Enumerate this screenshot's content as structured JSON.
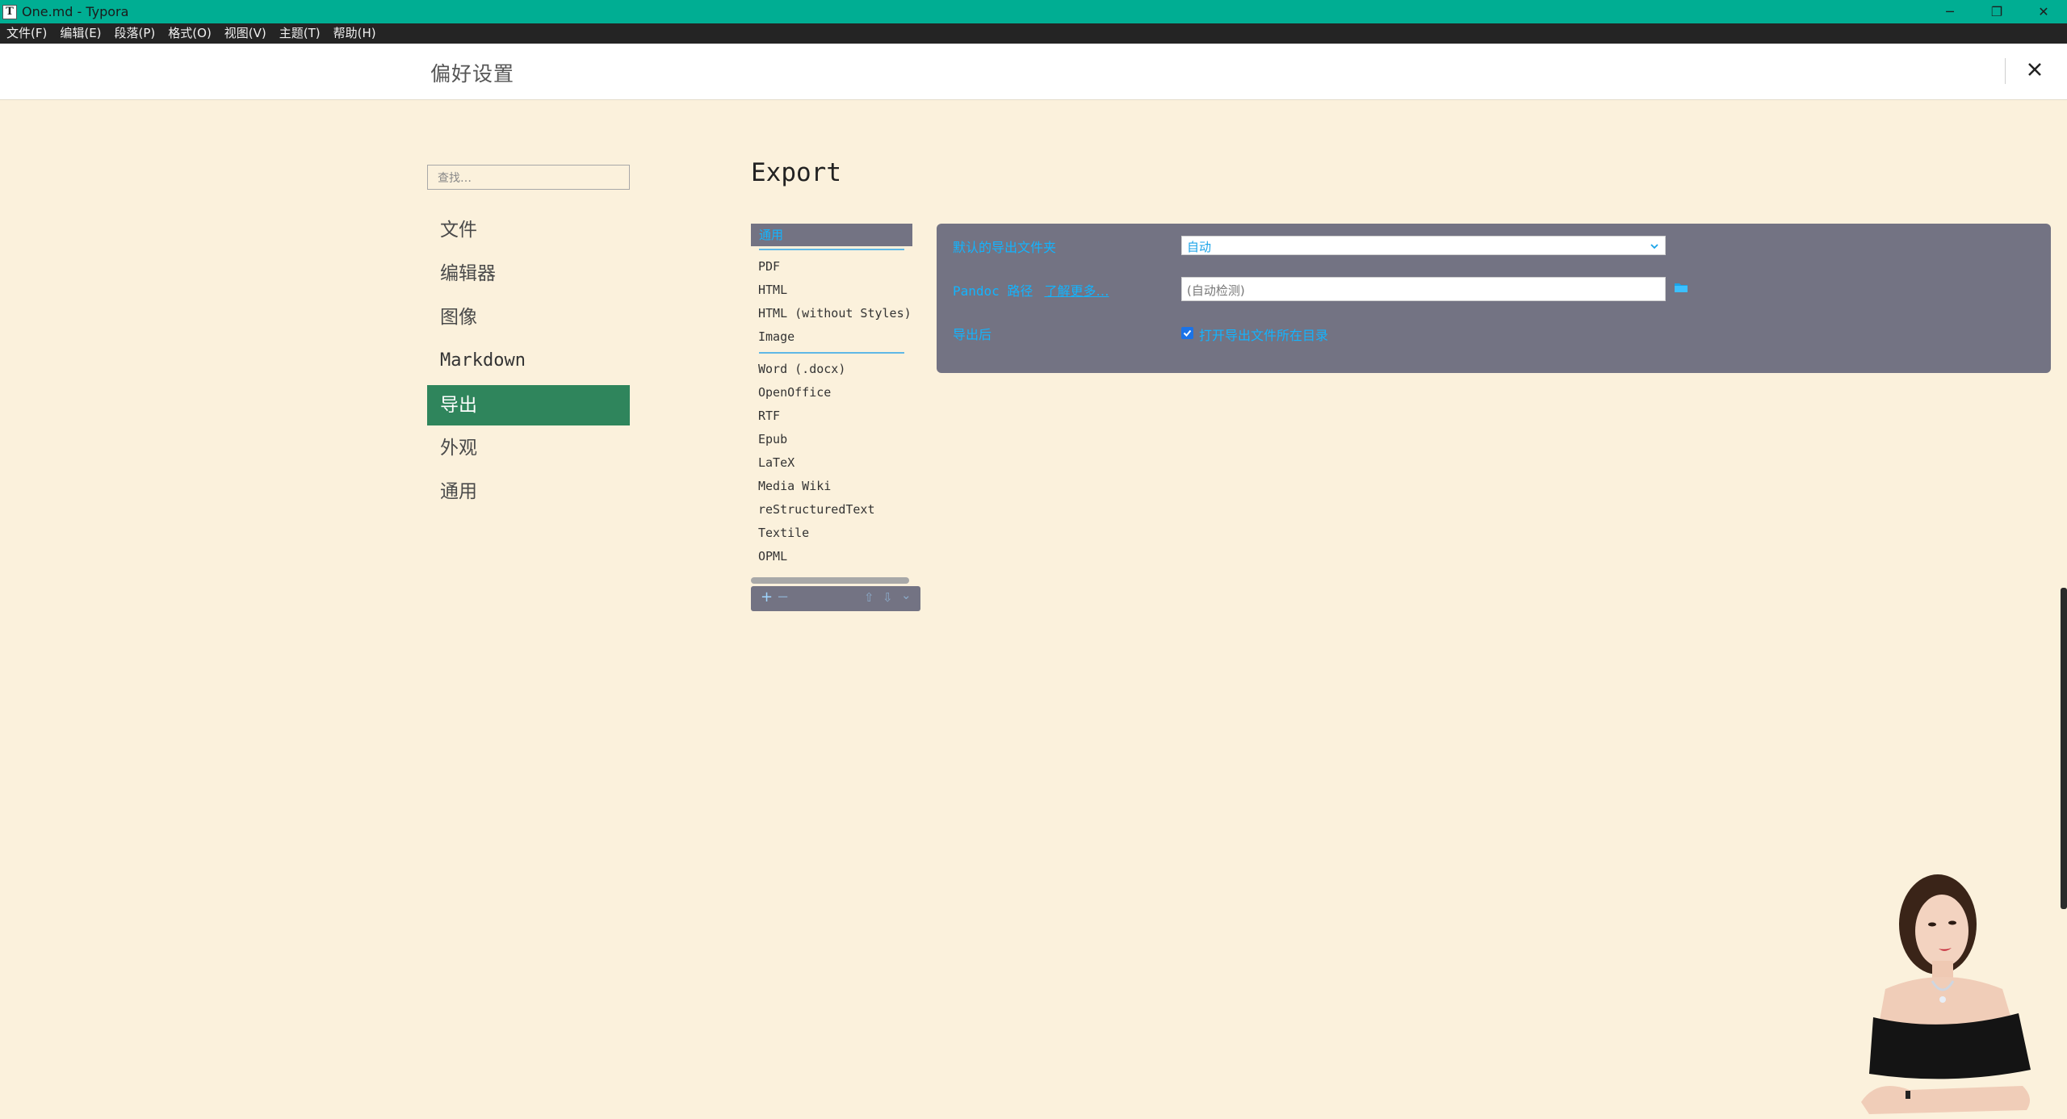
{
  "window": {
    "title": "One.md - Typora",
    "app_icon_letter": "T",
    "controls": {
      "minimize": "─",
      "restore": "❐",
      "close": "✕"
    }
  },
  "menubar": {
    "items": [
      "文件(F)",
      "编辑(E)",
      "段落(P)",
      "格式(O)",
      "视图(V)",
      "主题(T)",
      "帮助(H)"
    ]
  },
  "preferences": {
    "title": "偏好设置",
    "search_placeholder": "查找…",
    "categories": [
      "文件",
      "编辑器",
      "图像",
      "Markdown",
      "导出",
      "外观",
      "通用"
    ],
    "active_category": "导出"
  },
  "export": {
    "section_title": "Export",
    "profiles_group1": [
      "PDF",
      "HTML",
      "HTML (without Styles)",
      "Image"
    ],
    "profiles_group2": [
      "Word (.docx)",
      "OpenOffice",
      "RTF",
      "Epub",
      "LaTeX",
      "Media Wiki",
      "reStructuredText",
      "Textile",
      "OPML"
    ],
    "selected_profile": "通用",
    "toolbar": {
      "add": "+",
      "remove": "−",
      "up": "⇧",
      "down": "⇩",
      "more": "⌄"
    },
    "settings": {
      "default_folder_label": "默认的导出文件夹",
      "default_folder_value": "自动",
      "pandoc_label": "Pandoc 路径",
      "pandoc_link": "了解更多…",
      "pandoc_placeholder": "(自动检测)",
      "after_export_label": "导出后",
      "open_folder_checked": true,
      "open_folder_label": "打开导出文件所在目录"
    }
  },
  "colors": {
    "titlebar": "#00ae93",
    "menubar": "#242424",
    "background": "#fbf1dc",
    "active_category": "#2f855c",
    "panel": "#737383",
    "accent_text": "#12b4ff"
  }
}
